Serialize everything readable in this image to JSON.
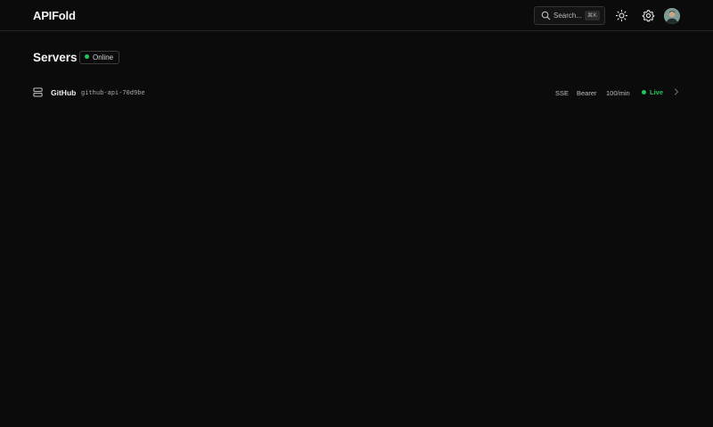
{
  "app": {
    "brand": "APIFold"
  },
  "search": {
    "placeholder": "Search...",
    "shortcut": "⌘K",
    "icon": "search-icon"
  },
  "header_actions": {
    "theme_icon": "sun-icon",
    "settings_icon": "gear-icon",
    "avatar_icon": "avatar"
  },
  "page": {
    "title": "Servers",
    "status_label": "Online",
    "status_color": "#22c55e"
  },
  "servers": [
    {
      "name": "GitHub",
      "slug": "github-api-70d9be",
      "transport": "SSE",
      "auth": "Bearer",
      "rate_limit": "100/min",
      "status": "Live",
      "icon": "server-icon"
    }
  ],
  "colors": {
    "background": "#0b0b0b",
    "accent_green": "#22c55e",
    "border": "#262626"
  }
}
